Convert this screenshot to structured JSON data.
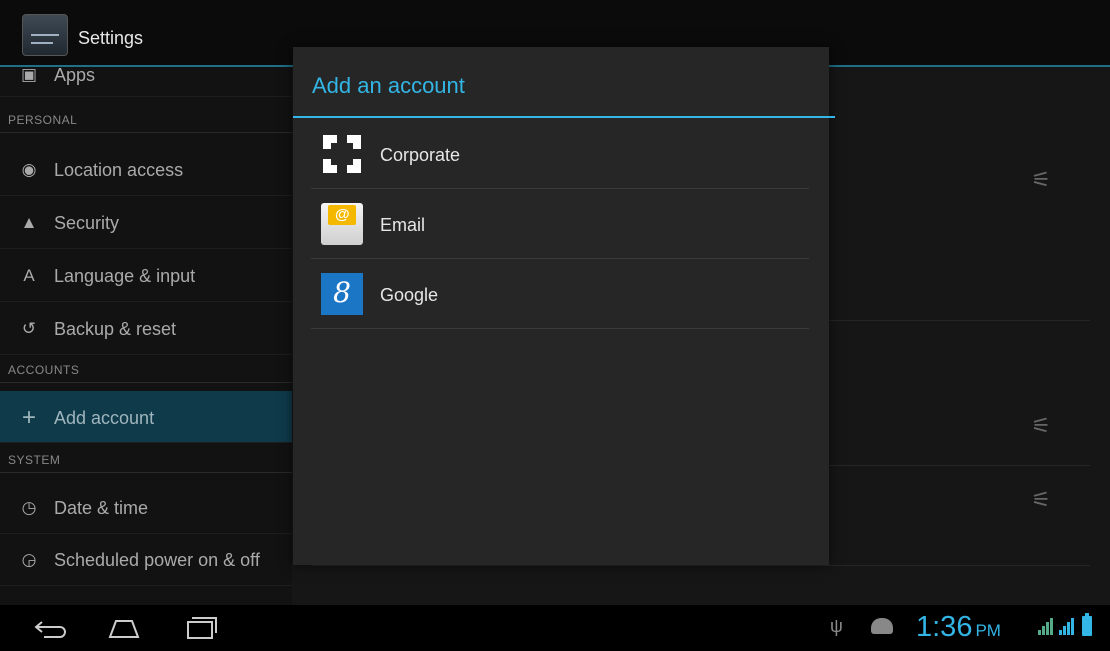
{
  "actionbar": {
    "title": "Settings"
  },
  "sidebar": {
    "items": [
      {
        "label": "Apps",
        "icon": "apps-icon"
      },
      {
        "header": "PERSONAL"
      },
      {
        "label": "Location access",
        "icon": "location-icon"
      },
      {
        "label": "Security",
        "icon": "lock-icon"
      },
      {
        "label": "Language & input",
        "icon": "language-icon"
      },
      {
        "label": "Backup & reset",
        "icon": "backup-icon"
      },
      {
        "header": "ACCOUNTS"
      },
      {
        "label": "Add account",
        "icon": "plus-icon",
        "selected": true
      },
      {
        "header": "SYSTEM"
      },
      {
        "label": "Date & time",
        "icon": "clock-icon"
      },
      {
        "label": "Scheduled power on & off",
        "icon": "power-schedule-icon"
      }
    ]
  },
  "dialog": {
    "title": "Add an account",
    "accounts": [
      {
        "label": "Corporate",
        "icon": "corporate-icon"
      },
      {
        "label": "Email",
        "icon": "email-icon"
      },
      {
        "label": "Google",
        "icon": "google-icon",
        "icon_text": "8"
      }
    ]
  },
  "statusbar": {
    "time": "1:36",
    "ampm": "PM"
  },
  "colors": {
    "accent": "#33b5e5",
    "selected": "#0f3a4a",
    "dialog_bg": "#262626"
  }
}
